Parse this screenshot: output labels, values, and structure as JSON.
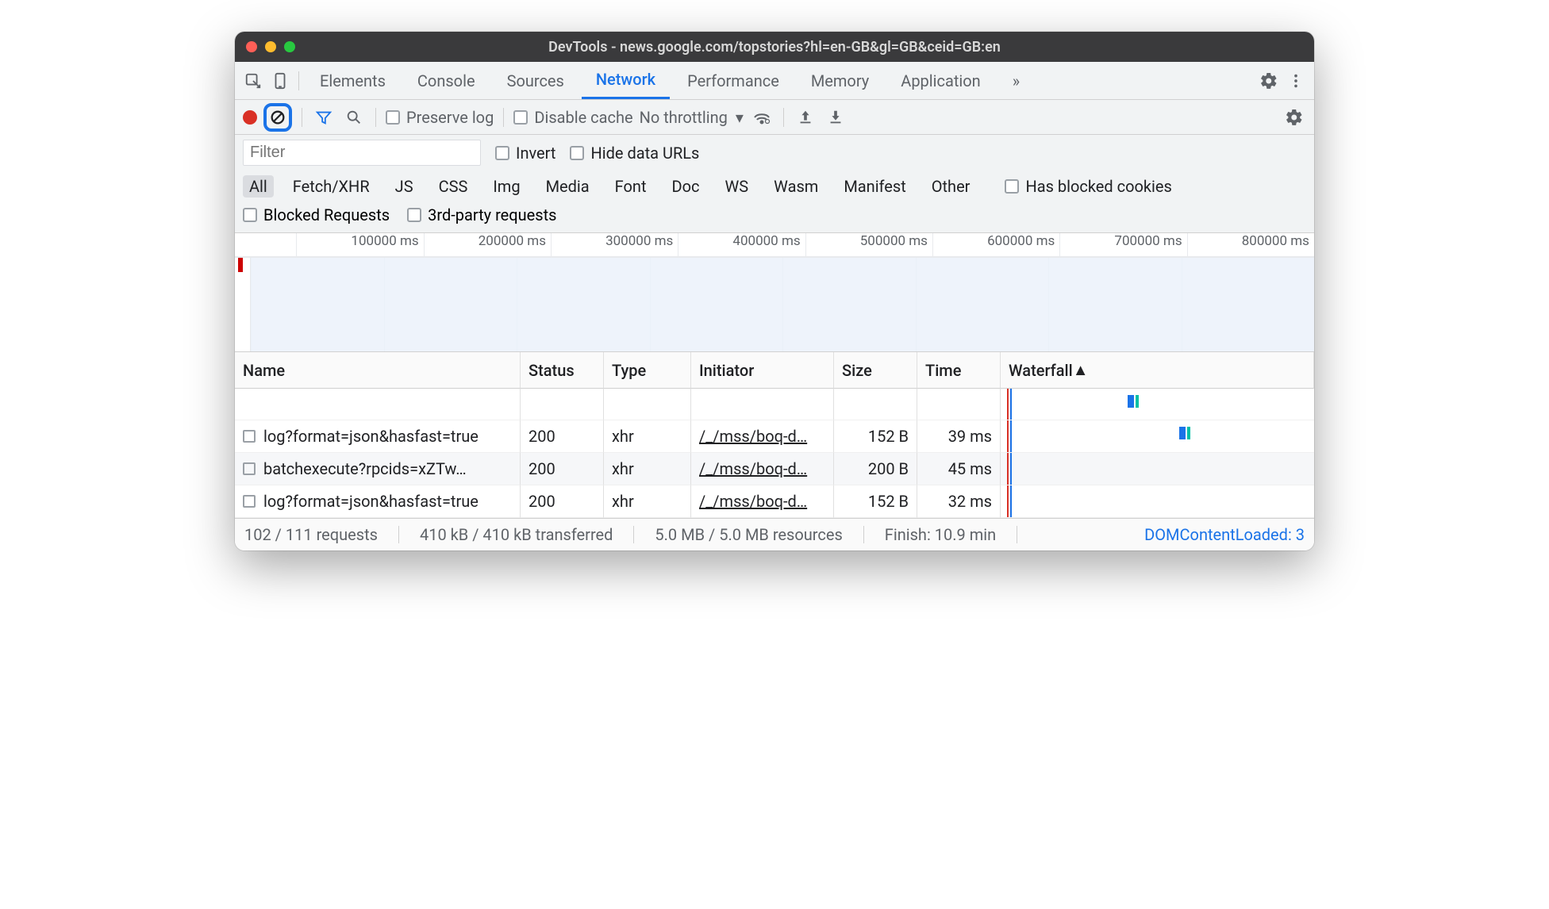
{
  "window": {
    "title": "DevTools - news.google.com/topstories?hl=en-GB&gl=GB&ceid=GB:en"
  },
  "tabs": [
    "Elements",
    "Console",
    "Sources",
    "Network",
    "Performance",
    "Memory",
    "Application"
  ],
  "tabs_more_glyph": "»",
  "net_toolbar": {
    "preserve_log": "Preserve log",
    "disable_cache": "Disable cache",
    "throttling": "No throttling"
  },
  "filter": {
    "placeholder": "Filter",
    "invert": "Invert",
    "hide_data_urls": "Hide data URLs"
  },
  "type_filters": [
    "All",
    "Fetch/XHR",
    "JS",
    "CSS",
    "Img",
    "Media",
    "Font",
    "Doc",
    "WS",
    "Wasm",
    "Manifest",
    "Other"
  ],
  "extra_filters": {
    "has_blocked_cookies": "Has blocked cookies",
    "blocked_requests": "Blocked Requests",
    "third_party": "3rd-party requests"
  },
  "timeline_ticks": [
    "",
    "100000 ms",
    "200000 ms",
    "300000 ms",
    "400000 ms",
    "500000 ms",
    "600000 ms",
    "700000 ms",
    "800000 ms"
  ],
  "columns": [
    "Name",
    "Status",
    "Type",
    "Initiator",
    "Size",
    "Time",
    "Waterfall"
  ],
  "rows": [
    {
      "name": "log?format=json&hasfast=true",
      "status": "200",
      "type": "xhr",
      "initiator": "/_/mss/boq-d…",
      "size": "152 B",
      "time": "39 ms"
    },
    {
      "name": "batchexecute?rpcids=xZTw…",
      "status": "200",
      "type": "xhr",
      "initiator": "/_/mss/boq-d…",
      "size": "200 B",
      "time": "45 ms"
    },
    {
      "name": "log?format=json&hasfast=true",
      "status": "200",
      "type": "xhr",
      "initiator": "/_/mss/boq-d…",
      "size": "152 B",
      "time": "32 ms"
    }
  ],
  "status": {
    "requests": "102 / 111 requests",
    "transferred": "410 kB / 410 kB transferred",
    "resources": "5.0 MB / 5.0 MB resources",
    "finish": "Finish: 10.9 min",
    "dcl": "DOMContentLoaded: 3"
  }
}
